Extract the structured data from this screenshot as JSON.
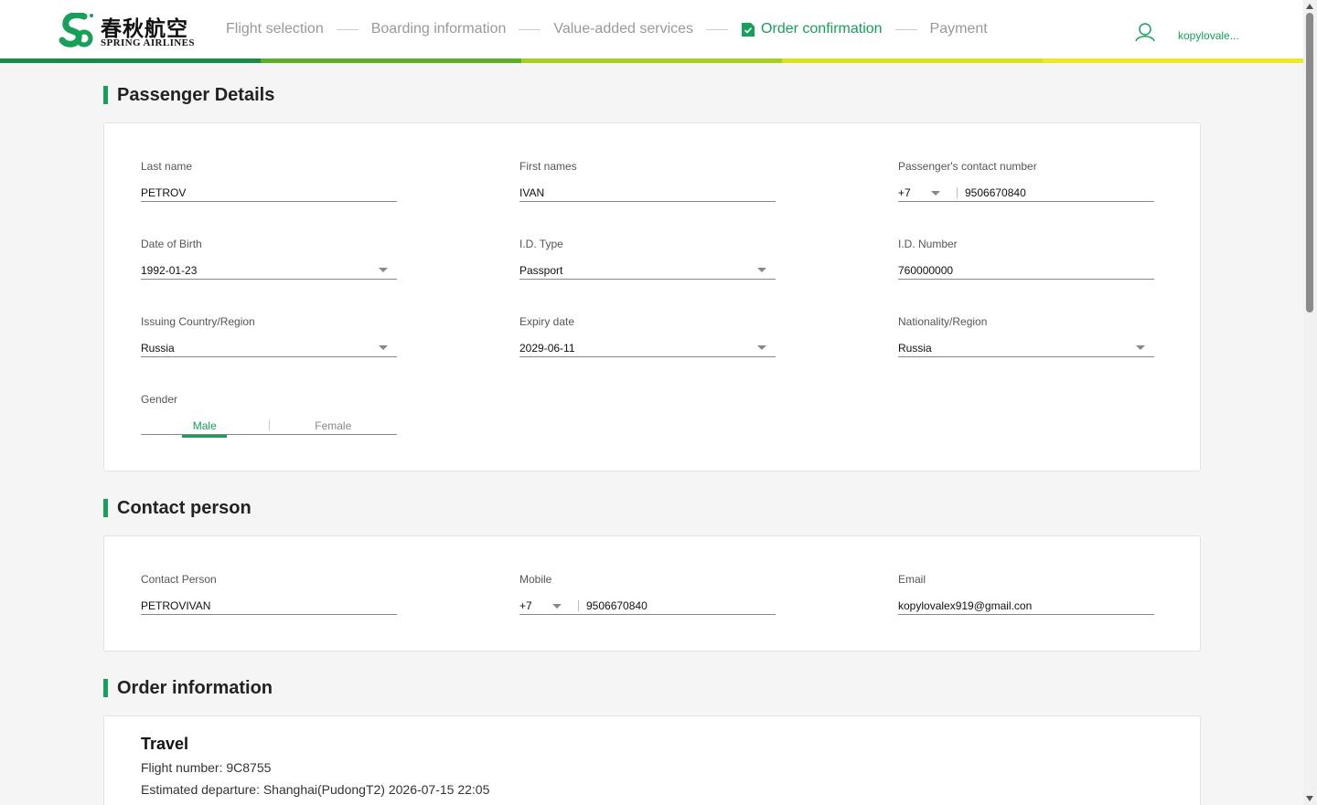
{
  "brand": {
    "name_cn": "春秋航空",
    "name_en": "SPRING  AIRLINES",
    "color": "#18a05a"
  },
  "steps": [
    {
      "label": "Flight selection",
      "state": "done"
    },
    {
      "label": "Boarding information",
      "state": "done"
    },
    {
      "label": "Value-added services",
      "state": "done"
    },
    {
      "label": "Order confirmation",
      "state": "active"
    },
    {
      "label": "Payment",
      "state": "pending"
    }
  ],
  "user": {
    "name": "kopylovale..."
  },
  "progress_colors": [
    "#1a8a4a",
    "#5cae28",
    "#a6cf1e",
    "#d9e31a",
    "#eaea1e"
  ],
  "passenger": {
    "title": "Passenger Details",
    "last_name": {
      "label": "Last name",
      "value": "PETROV"
    },
    "first_names": {
      "label": "First names",
      "value": "IVAN"
    },
    "contact_number": {
      "label": "Passenger's contact number",
      "code": "+7",
      "value": "9506670840"
    },
    "dob": {
      "label": "Date of Birth",
      "value": "1992-01-23"
    },
    "id_type": {
      "label": "I.D. Type",
      "value": "Passport"
    },
    "id_number": {
      "label": "I.D. Number",
      "value": "760000000"
    },
    "issuing_country": {
      "label": "Issuing Country/Region",
      "value": "Russia"
    },
    "expiry": {
      "label": "Expiry date",
      "value": "2029-06-11"
    },
    "nationality": {
      "label": "Nationality/Region",
      "value": "Russia"
    },
    "gender": {
      "label": "Gender",
      "options": [
        "Male",
        "Female"
      ],
      "selected": "Male"
    }
  },
  "contact": {
    "title": "Contact person",
    "person": {
      "label": "Contact Person",
      "value": "PETROVIVAN"
    },
    "mobile": {
      "label": "Mobile",
      "code": "+7",
      "value": "9506670840"
    },
    "email": {
      "label": "Email",
      "value": "kopylovalex919@gmail.con"
    }
  },
  "order": {
    "title": "Order information",
    "travel_heading": "Travel",
    "flight_number": "Flight number: 9C8755",
    "departure": "Estimated departure: Shanghai(PudongT2) 2026-07-15 22:05"
  }
}
